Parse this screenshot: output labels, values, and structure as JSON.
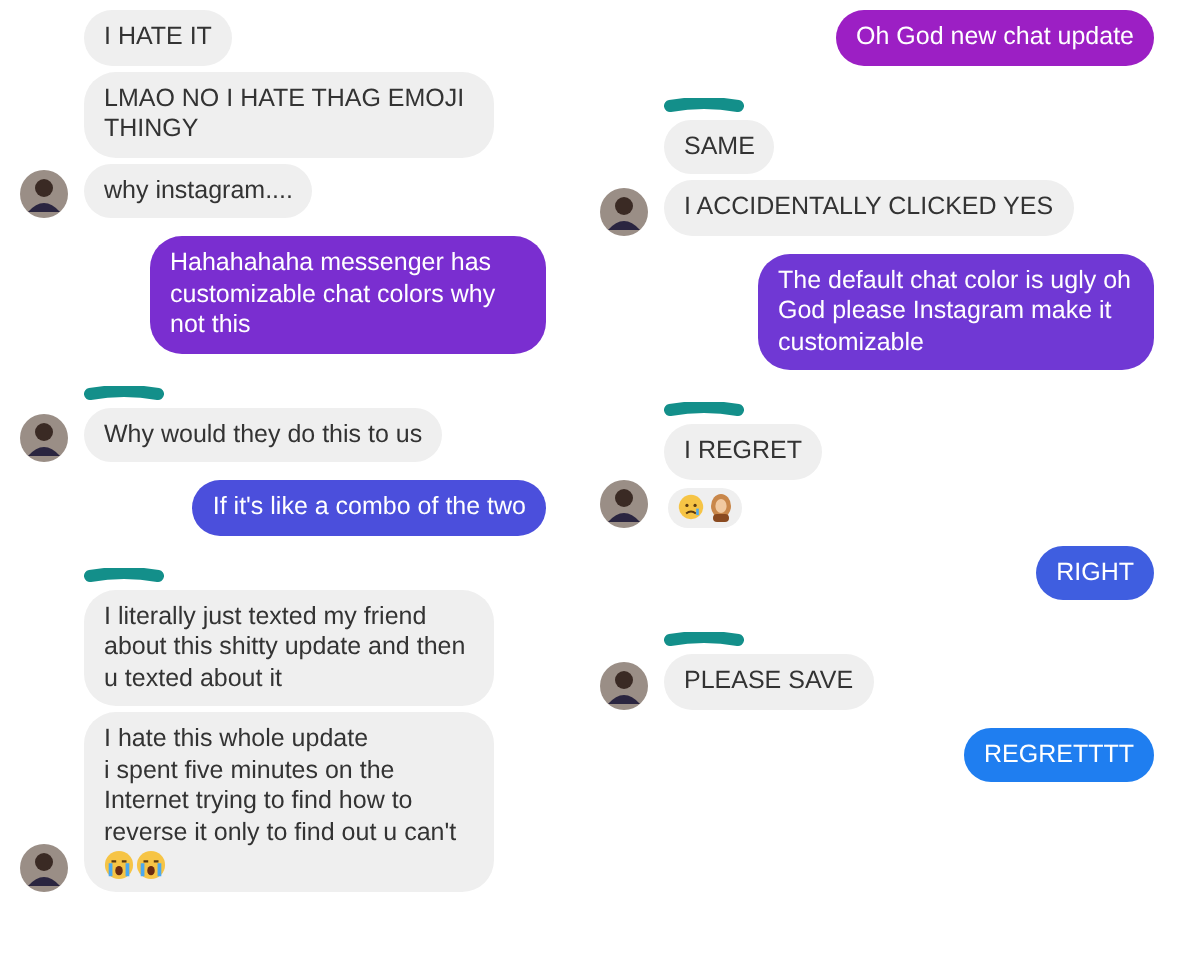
{
  "columns": [
    {
      "messages": [
        {
          "kind": "in",
          "text": "I HATE IT",
          "avatar": false
        },
        {
          "kind": "in",
          "text": "LMAO NO I HATE THAG EMOJI THINGY",
          "avatar": false
        },
        {
          "kind": "in",
          "text": "why instagram....",
          "avatar": true
        },
        {
          "kind": "out",
          "text": "Hahahahaha messenger has customizable chat colors why not this",
          "color": "#7a2ed0"
        },
        {
          "kind": "mark"
        },
        {
          "kind": "in",
          "text": "Why would they do this to us",
          "avatar": true
        },
        {
          "kind": "out",
          "text": "If it's like a combo of the two",
          "color": "#4b4fdc"
        },
        {
          "kind": "mark"
        },
        {
          "kind": "in",
          "text": "I literally just texted my friend about this shitty update and then u texted about it",
          "avatar": false
        },
        {
          "kind": "in",
          "text": "I hate this whole update\ni spent five minutes on the Internet trying to find how to reverse it only to find out u can't",
          "avatar": true,
          "emojis": [
            {
              "kind": "crying"
            },
            {
              "kind": "crying"
            }
          ]
        }
      ]
    },
    {
      "messages": [
        {
          "kind": "out",
          "text": "Oh God new chat update",
          "color": "#9c1fc4"
        },
        {
          "kind": "mark"
        },
        {
          "kind": "in",
          "text": "SAME",
          "avatar": false
        },
        {
          "kind": "in",
          "text": "I ACCIDENTALLY CLICKED YES",
          "avatar": true
        },
        {
          "kind": "out",
          "text": "The default chat color is ugly oh God please Instagram make it customizable",
          "color": "#7038d4"
        },
        {
          "kind": "mark"
        },
        {
          "kind": "in",
          "text": "I REGRET",
          "avatar": false
        },
        {
          "kind": "reactions",
          "avatar": true,
          "items": [
            {
              "kind": "sad"
            },
            {
              "kind": "person"
            }
          ]
        },
        {
          "kind": "out",
          "text": "RIGHT",
          "color": "#3f5ee0"
        },
        {
          "kind": "mark"
        },
        {
          "kind": "in",
          "text": "PLEASE SAVE",
          "avatar": true
        },
        {
          "kind": "out",
          "text": "REGRETTTT",
          "color": "#1f7ef0"
        }
      ]
    }
  ]
}
